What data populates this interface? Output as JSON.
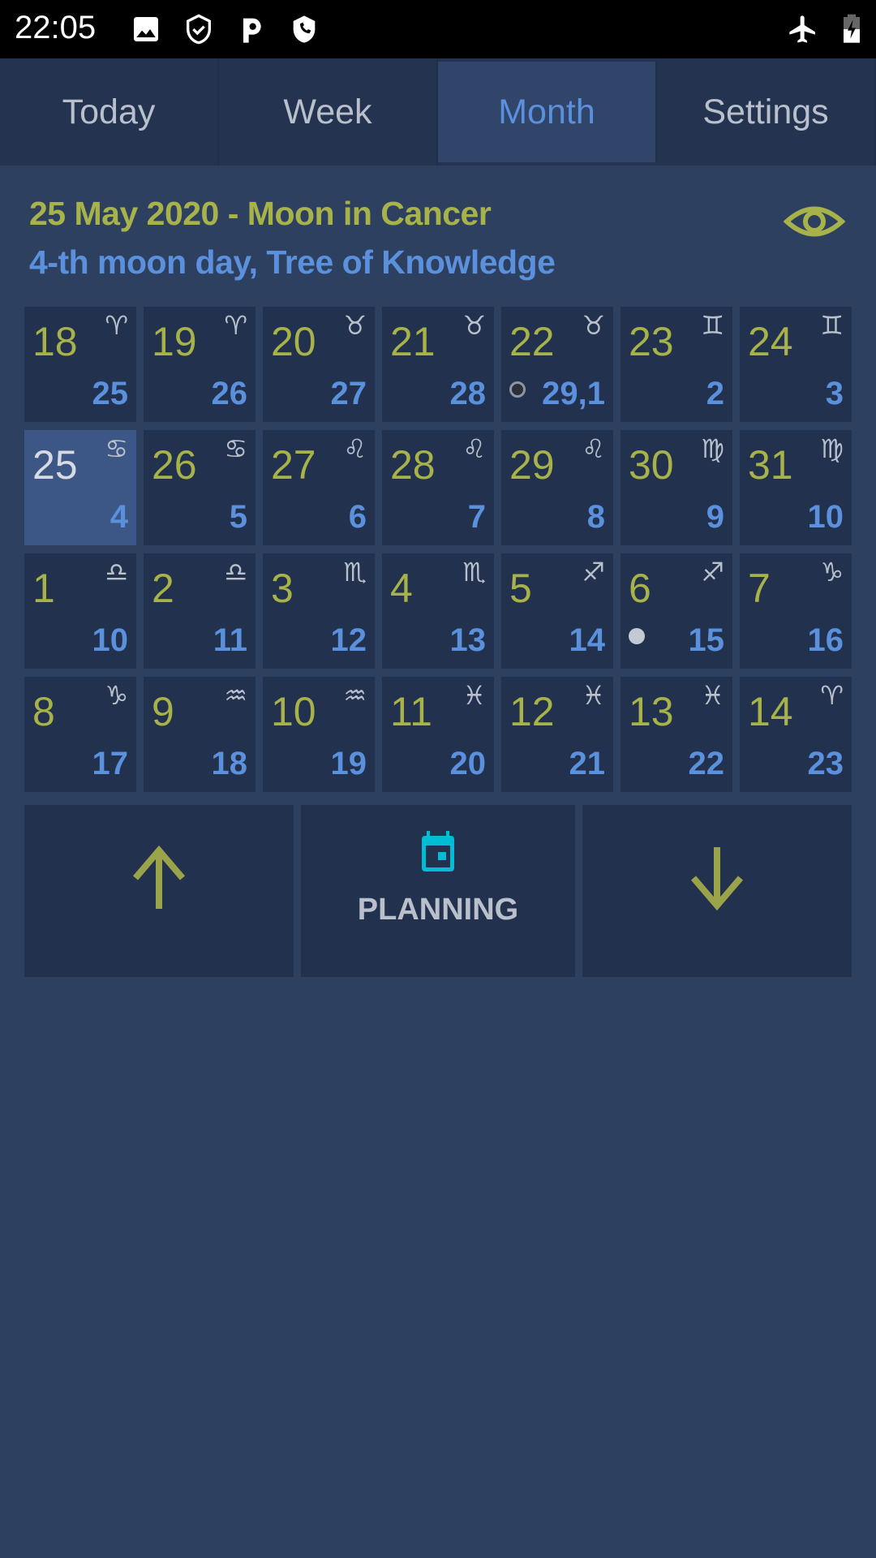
{
  "status_bar": {
    "time": "22:05",
    "left_icons": [
      "image-icon",
      "shield-check-icon",
      "parking-icon",
      "shield-phone-icon"
    ],
    "right_icons": [
      "airplane-mode-icon",
      "battery-charging-icon"
    ]
  },
  "tabs": [
    {
      "label": "Today",
      "active": false
    },
    {
      "label": "Week",
      "active": false
    },
    {
      "label": "Month",
      "active": true
    },
    {
      "label": "Settings",
      "active": false
    }
  ],
  "header": {
    "title": "25 May 2020 - Moon in Cancer",
    "subtitle": "4-th moon day, Tree of Knowledge",
    "eye_icon": "eye-icon"
  },
  "colors": {
    "background": "#2e4060",
    "cell": "#22314d",
    "today_cell": "#3c5685",
    "day_number": "#a8b24a",
    "moon_day": "#5b90dc",
    "sign": "#b9c0cc",
    "planning_icon": "#00bcd4"
  },
  "calendar": {
    "days": [
      {
        "day": "18",
        "sign": "♈",
        "sign_name": "aries",
        "moon_day": "25"
      },
      {
        "day": "19",
        "sign": "♈",
        "sign_name": "aries",
        "moon_day": "26"
      },
      {
        "day": "20",
        "sign": "♉",
        "sign_name": "taurus",
        "moon_day": "27"
      },
      {
        "day": "21",
        "sign": "♉",
        "sign_name": "taurus",
        "moon_day": "28"
      },
      {
        "day": "22",
        "sign": "♉",
        "sign_name": "taurus",
        "moon_day": "29,1",
        "phase": "new"
      },
      {
        "day": "23",
        "sign": "♊",
        "sign_name": "gemini",
        "moon_day": "2"
      },
      {
        "day": "24",
        "sign": "♊",
        "sign_name": "gemini",
        "moon_day": "3"
      },
      {
        "day": "25",
        "sign": "♋",
        "sign_name": "cancer",
        "moon_day": "4",
        "today": true
      },
      {
        "day": "26",
        "sign": "♋",
        "sign_name": "cancer",
        "moon_day": "5"
      },
      {
        "day": "27",
        "sign": "♌",
        "sign_name": "leo",
        "moon_day": "6"
      },
      {
        "day": "28",
        "sign": "♌",
        "sign_name": "leo",
        "moon_day": "7"
      },
      {
        "day": "29",
        "sign": "♌",
        "sign_name": "leo",
        "moon_day": "8"
      },
      {
        "day": "30",
        "sign": "♍",
        "sign_name": "virgo",
        "moon_day": "9"
      },
      {
        "day": "31",
        "sign": "♍",
        "sign_name": "virgo",
        "moon_day": "10"
      },
      {
        "day": "1",
        "sign": "♎",
        "sign_name": "libra",
        "moon_day": "10"
      },
      {
        "day": "2",
        "sign": "♎",
        "sign_name": "libra",
        "moon_day": "11"
      },
      {
        "day": "3",
        "sign": "♏",
        "sign_name": "scorpio",
        "moon_day": "12"
      },
      {
        "day": "4",
        "sign": "♏",
        "sign_name": "scorpio",
        "moon_day": "13"
      },
      {
        "day": "5",
        "sign": "♐",
        "sign_name": "sagittarius",
        "moon_day": "14"
      },
      {
        "day": "6",
        "sign": "♐",
        "sign_name": "sagittarius",
        "moon_day": "15",
        "phase": "full"
      },
      {
        "day": "7",
        "sign": "♑",
        "sign_name": "capricorn",
        "moon_day": "16"
      },
      {
        "day": "8",
        "sign": "♑",
        "sign_name": "capricorn",
        "moon_day": "17"
      },
      {
        "day": "9",
        "sign": "♒",
        "sign_name": "aquarius",
        "moon_day": "18"
      },
      {
        "day": "10",
        "sign": "♒",
        "sign_name": "aquarius",
        "moon_day": "19"
      },
      {
        "day": "11",
        "sign": "♓",
        "sign_name": "pisces",
        "moon_day": "20"
      },
      {
        "day": "12",
        "sign": "♓",
        "sign_name": "pisces",
        "moon_day": "21"
      },
      {
        "day": "13",
        "sign": "♓",
        "sign_name": "pisces",
        "moon_day": "22"
      },
      {
        "day": "14",
        "sign": "♈",
        "sign_name": "aries",
        "moon_day": "23"
      }
    ]
  },
  "actions": {
    "prev_icon": "arrow-up-icon",
    "planning_label": "PLANNING",
    "planning_icon": "calendar-icon",
    "next_icon": "arrow-down-icon"
  }
}
